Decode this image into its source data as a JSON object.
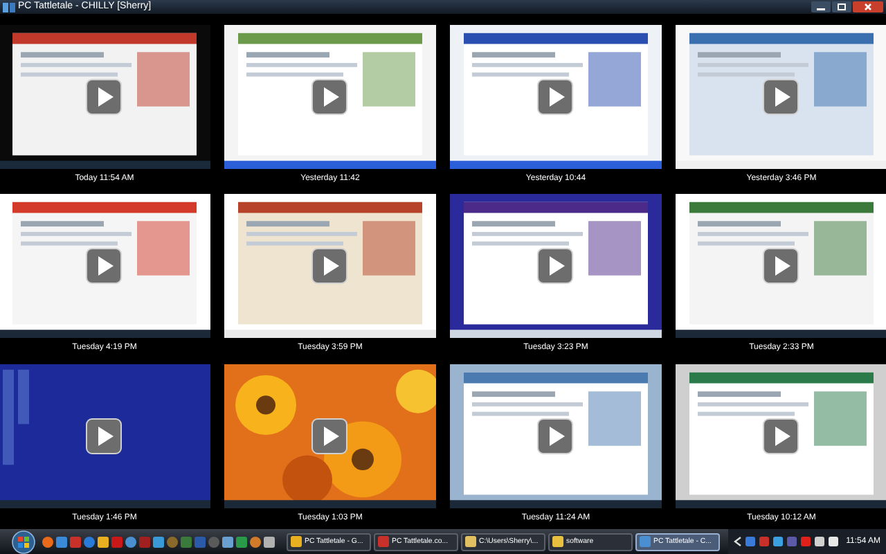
{
  "window": {
    "title": "PC Tattletale - CHILLY [Sherry]"
  },
  "captures": [
    {
      "time": "Today 11:54 AM",
      "kind": "picture"
    },
    {
      "time": "Yesterday 11:42",
      "kind": "picture"
    },
    {
      "time": "Yesterday 10:44",
      "kind": "picture"
    },
    {
      "time": "Yesterday 3:46 PM",
      "kind": "picture"
    },
    {
      "time": "Tuesday 4:19 PM",
      "kind": "picture"
    },
    {
      "time": "Tuesday 3:59 PM",
      "kind": "picture"
    },
    {
      "time": "Tuesday 3:23 PM",
      "kind": "picture"
    },
    {
      "time": "Tuesday 2:33 PM",
      "kind": "picture"
    },
    {
      "time": "Tuesday 1:46 PM",
      "kind": "picture"
    },
    {
      "time": "Tuesday 1:03 PM",
      "kind": "picture"
    },
    {
      "time": "Tuesday 11:24 AM",
      "kind": "picture"
    },
    {
      "time": "Tuesday 10:12 AM",
      "kind": "picture"
    }
  ],
  "taskbar": {
    "tasks": [
      {
        "label": "PC Tattletale - G...",
        "selected": false
      },
      {
        "label": "PC Tattletale.co...",
        "selected": false
      },
      {
        "label": "C:\\Users\\Sherry\\...",
        "selected": false
      },
      {
        "label": "software",
        "selected": false
      },
      {
        "label": "PC Tattletale - C...",
        "selected": true
      }
    ],
    "clock": "11:54 AM"
  }
}
